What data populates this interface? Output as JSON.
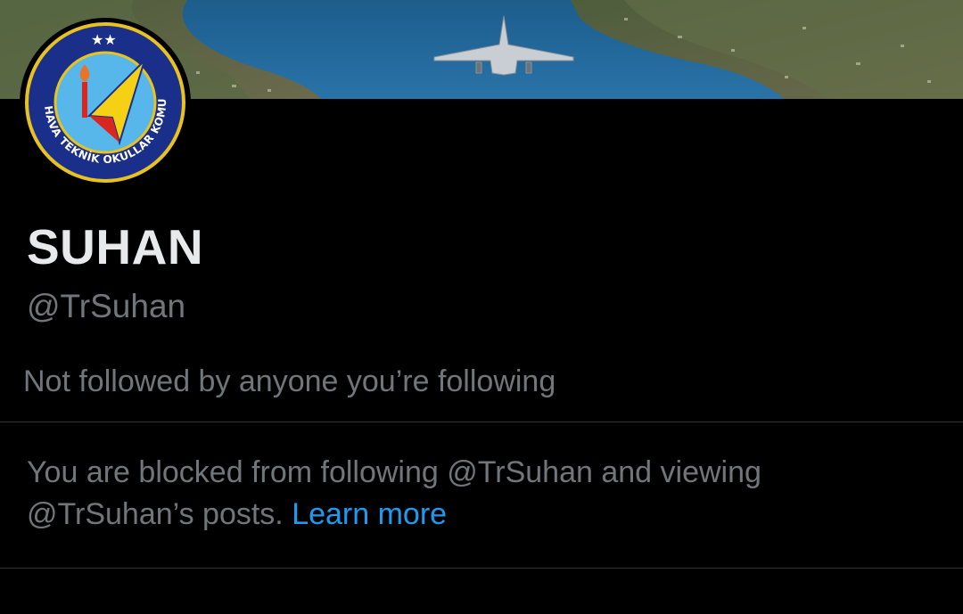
{
  "profile": {
    "display_name": "SUHAN",
    "handle": "@TrSuhan",
    "followers_context": "Not followed by anyone you’re following",
    "banner": {
      "icon": "coastal-jet-banner-image"
    },
    "avatar": {
      "icon": "hava-teknik-okullar-emblem",
      "emblem_text": "HAVA TEKNİK OKULLAR KOMUTANLIĞI"
    }
  },
  "notice": {
    "text_part1": "You are blocked from following @TrSuhan and viewing @TrSuhan’s posts. ",
    "link_label": "Learn more"
  },
  "colors": {
    "background": "#000000",
    "primary_text": "#e7e9ea",
    "secondary_text": "#71767b",
    "link": "#1d9bf0",
    "divider": "#2f3336"
  }
}
